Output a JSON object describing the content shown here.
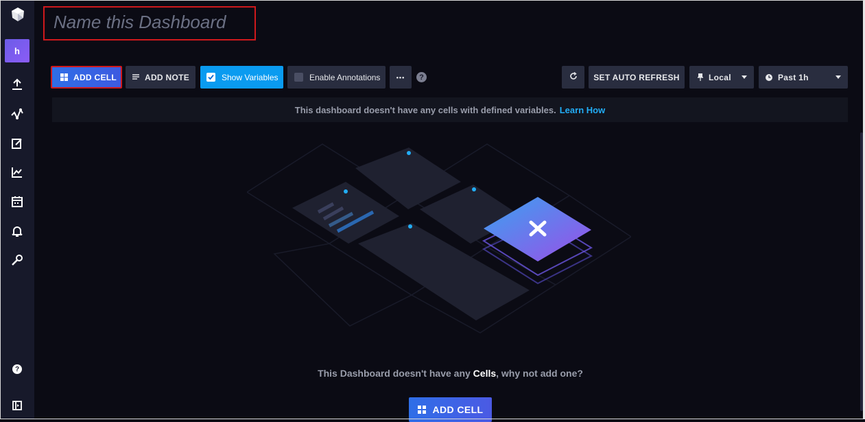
{
  "sidebar": {
    "org_initial": "h",
    "help": "?",
    "items": [
      {
        "icon": "upload-icon"
      },
      {
        "icon": "data-explorer-icon"
      },
      {
        "icon": "notebook-icon"
      },
      {
        "icon": "dashboards-icon"
      },
      {
        "icon": "tasks-icon"
      },
      {
        "icon": "alerts-bell-icon"
      },
      {
        "icon": "settings-wrench-icon"
      }
    ]
  },
  "dashboard": {
    "name_placeholder": "Name this Dashboard"
  },
  "toolbar": {
    "add_cell": "ADD CELL",
    "add_note": "ADD NOTE",
    "show_variables": "Show Variables",
    "show_variables_checked": true,
    "enable_annotations": "Enable Annotations",
    "enable_annotations_checked": false,
    "more": "•••",
    "help": "?",
    "auto_refresh": "SET AUTO REFRESH",
    "timezone": "Local",
    "time_range": "Past 1h"
  },
  "notice": {
    "text": "This dashboard doesn't have any cells with defined variables.",
    "link": "Learn How"
  },
  "empty_state": {
    "text_before": "This Dashboard doesn't have any",
    "text_bold": "Cells",
    "text_after": ", why not add one?",
    "button": "ADD CELL"
  },
  "colors": {
    "background": "#0b0b14",
    "sidebar": "#17192a",
    "primary_blue": "#2f6ee7",
    "checkbox_blue": "#0a9bf0",
    "link": "#22adf6",
    "highlight_red": "#d0191c"
  }
}
